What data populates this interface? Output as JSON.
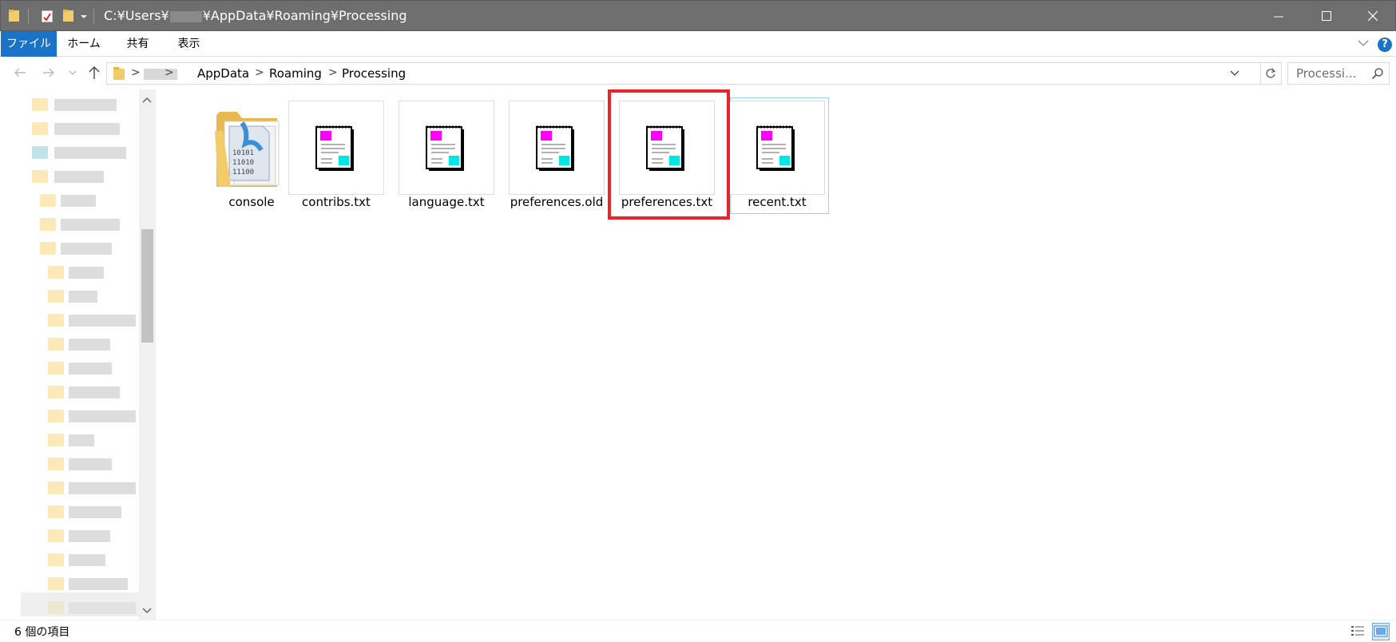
{
  "titlebar": {
    "path_prefix": "C:¥Users¥",
    "path_suffix": "¥AppData¥Roaming¥Processing"
  },
  "ribbon": {
    "tabs": [
      {
        "label": "ファイル"
      },
      {
        "label": "ホーム"
      },
      {
        "label": "共有"
      },
      {
        "label": "表示"
      }
    ],
    "help_glyph": "?"
  },
  "address": {
    "crumbs": [
      "AppData",
      "Roaming",
      "Processing"
    ],
    "separator": ">"
  },
  "search": {
    "placeholder": "Processi..."
  },
  "files": [
    {
      "name": "console",
      "kind": "folder"
    },
    {
      "name": "contribs.txt",
      "kind": "text-file"
    },
    {
      "name": "language.txt",
      "kind": "text-file"
    },
    {
      "name": "preferences.old",
      "kind": "text-file"
    },
    {
      "name": "preferences.txt",
      "kind": "text-file",
      "highlighted": true
    },
    {
      "name": "recent.txt",
      "kind": "text-file",
      "hovered": true
    }
  ],
  "folder_binary_lines": [
    "10101",
    "11010",
    "11100"
  ],
  "status": {
    "item_count_text": "6 個の項目"
  },
  "colors": {
    "titlebar_bg": "#6e6e6e",
    "accent_blue": "#1a73c7",
    "highlight_red": "#e8252a",
    "icon_magenta": "#ff00ff",
    "icon_cyan": "#00e5e5",
    "folder_yellow": "#f3cc6a"
  }
}
